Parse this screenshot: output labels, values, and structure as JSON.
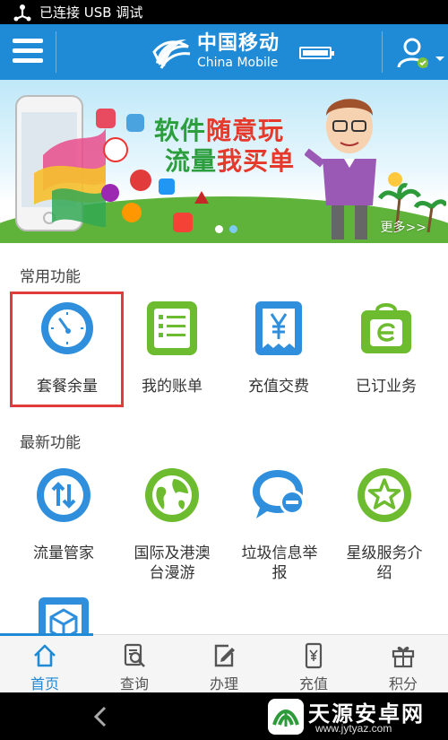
{
  "status_bar": {
    "text": "已连接 USB 调试",
    "icon": "usb-icon"
  },
  "header": {
    "brand_cn": "中国移动",
    "brand_en": "China Mobile",
    "menu_icon": "menu-icon",
    "user_icon": "user-icon",
    "accent": "#1f8ad6"
  },
  "banner": {
    "slogan_line1_a": "软件",
    "slogan_line1_b": "随意玩",
    "slogan_line2_a": "流量",
    "slogan_line2_b": "我买单",
    "more": "更多>>",
    "slide_count": 2,
    "active_slide": 1
  },
  "common": {
    "title": "常用功能",
    "items": [
      {
        "label": "套餐余量",
        "icon": "gauge-icon"
      },
      {
        "label": "我的账单",
        "icon": "bill-icon"
      },
      {
        "label": "充值交费",
        "icon": "yuan-icon"
      },
      {
        "label": "已订业务",
        "icon": "bag-icon"
      }
    ]
  },
  "latest": {
    "title": "最新功能",
    "items": [
      {
        "label": "流量管家",
        "icon": "traffic-arrows-icon"
      },
      {
        "label": "国际及港澳台漫游",
        "line1": "国际及港澳",
        "line2": "台漫游",
        "icon": "globe-icon"
      },
      {
        "label": "垃圾信息举报",
        "line1": "垃圾信息举",
        "line2": "报",
        "icon": "spam-report-icon"
      },
      {
        "label": "星级服务介绍",
        "line1": "星级服务介",
        "line2": "绍",
        "icon": "star-icon"
      },
      {
        "label": "",
        "icon": "box-icon"
      }
    ]
  },
  "tabs": [
    {
      "label": "首页",
      "icon": "home-icon",
      "active": true
    },
    {
      "label": "查询",
      "icon": "query-icon",
      "active": false
    },
    {
      "label": "办理",
      "icon": "edit-icon",
      "active": false
    },
    {
      "label": "充值",
      "icon": "phone-recharge-icon",
      "active": false
    },
    {
      "label": "积分",
      "icon": "gift-icon",
      "active": false
    }
  ],
  "watermark": {
    "cn": "天源安卓网",
    "url": "www.jytyaz.com"
  },
  "colors": {
    "highlight": "#e23b3b",
    "tile_blue": "#2f8fdc",
    "tile_green": "#6dbb2f"
  }
}
